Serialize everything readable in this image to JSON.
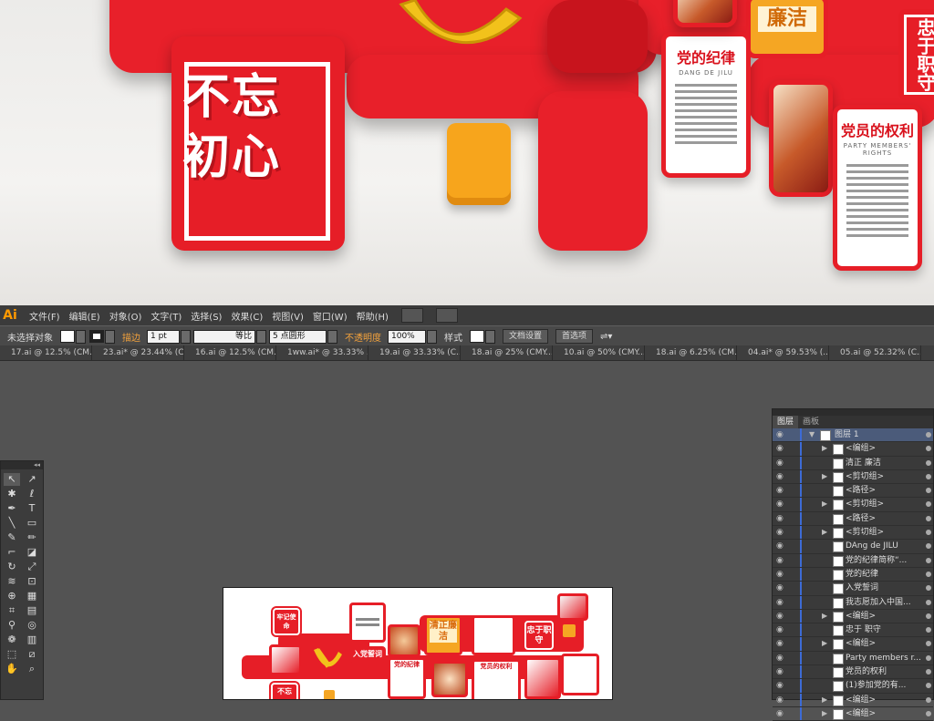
{
  "hero": {
    "slogan": "不忘初心",
    "cards": [
      {
        "title": "党的纪律",
        "subtitle": "DANG DE JILU"
      },
      {
        "title": "党员的权利",
        "subtitle": "PARTY MEMBERS' RIGHTS"
      }
    ],
    "gold_card": "廉洁",
    "vertical_card": "忠于职守"
  },
  "menubar": {
    "logo": "Ai",
    "items": [
      "文件(F)",
      "编辑(E)",
      "对象(O)",
      "文字(T)",
      "选择(S)",
      "效果(C)",
      "视图(V)",
      "窗口(W)",
      "帮助(H)"
    ]
  },
  "controlbar": {
    "selection": "未选择对象",
    "stroke_label": "描边",
    "stroke_weight": "1 pt",
    "profile": "等比",
    "brush": "5 点圆形",
    "opacity_label": "不透明度",
    "opacity": "100%",
    "style_label": "样式",
    "doc_setup": "文档设置",
    "preferences": "首选项"
  },
  "tabs": [
    "17.ai @ 12.5% (CM...",
    "23.ai* @ 23.44% (C...",
    "16.ai @ 12.5% (CM...",
    "1ww.ai* @ 33.33% ...",
    "19.ai @ 33.33% (C...",
    "18.ai @ 25% (CMY...",
    "10.ai @ 50% (CMY...",
    "18.ai @ 6.25% (CM...",
    "04.ai* @ 59.53% (...",
    "05.ai @ 52.32% (C..."
  ],
  "artboard": {
    "red_boxes": [
      "牢记使命",
      "忠于职守"
    ],
    "gold": "清正廉洁",
    "join": "入党誓词",
    "disc": "党的纪律",
    "rights": "党员的权利",
    "slogan_small": "不忘"
  },
  "layers_panel": {
    "tabs": [
      "图层",
      "画板"
    ],
    "rows": [
      {
        "name": "图层 1",
        "expand": true
      },
      {
        "name": "<编组>",
        "expand": true
      },
      {
        "name": "清正 廉洁",
        "expand": false
      },
      {
        "name": "<剪切组>",
        "expand": true
      },
      {
        "name": "<路径>",
        "expand": false
      },
      {
        "name": "<剪切组>",
        "expand": true
      },
      {
        "name": "<路径>",
        "expand": false
      },
      {
        "name": "<剪切组>",
        "expand": true
      },
      {
        "name": "DAng de JILU",
        "expand": false
      },
      {
        "name": "党的纪律简称“...",
        "expand": false
      },
      {
        "name": "党的纪律",
        "expand": false
      },
      {
        "name": "入党誓词",
        "expand": false
      },
      {
        "name": "我志愿加入中国...",
        "expand": false
      },
      {
        "name": "<编组>",
        "expand": true
      },
      {
        "name": "忠于 职守",
        "expand": false
      },
      {
        "name": "<编组>",
        "expand": true
      },
      {
        "name": "Party members r...",
        "expand": false
      },
      {
        "name": "党员的权利",
        "expand": false
      },
      {
        "name": "(1)参加党的有...",
        "expand": false
      },
      {
        "name": "<编组>",
        "expand": true
      },
      {
        "name": "<编组>",
        "expand": true
      }
    ]
  }
}
